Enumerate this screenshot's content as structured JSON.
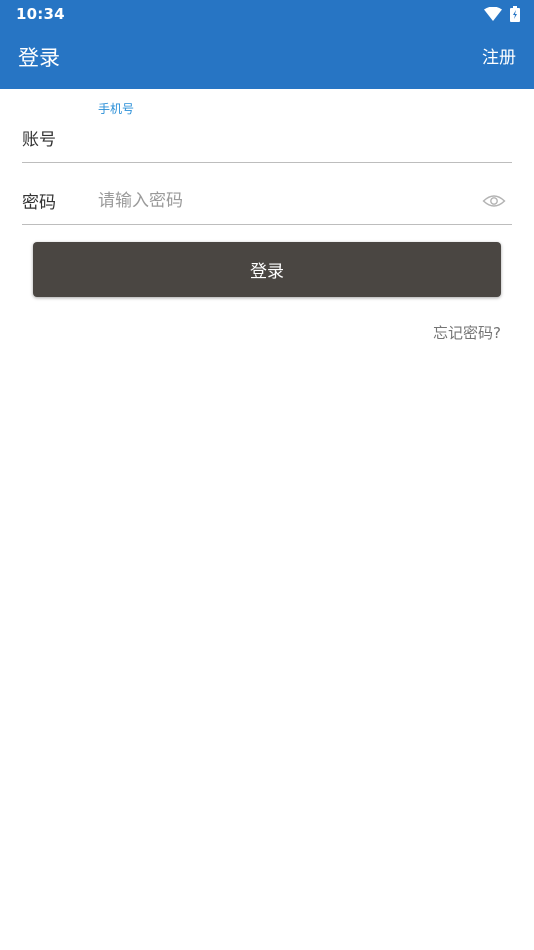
{
  "status_bar": {
    "time": "10:34",
    "icons": [
      "wifi-icon",
      "battery-icon"
    ]
  },
  "app_bar": {
    "title": "登录",
    "register_label": "注册",
    "color": "#2775c4"
  },
  "form": {
    "account": {
      "label": "账号",
      "hint": "手机号",
      "value": ""
    },
    "password": {
      "label": "密码",
      "placeholder": "请输入密码",
      "toggle_icon": "eye-icon"
    },
    "login_button_label": "登录",
    "login_button_color": "#4a4642",
    "forgot_label": "忘记密码?"
  }
}
